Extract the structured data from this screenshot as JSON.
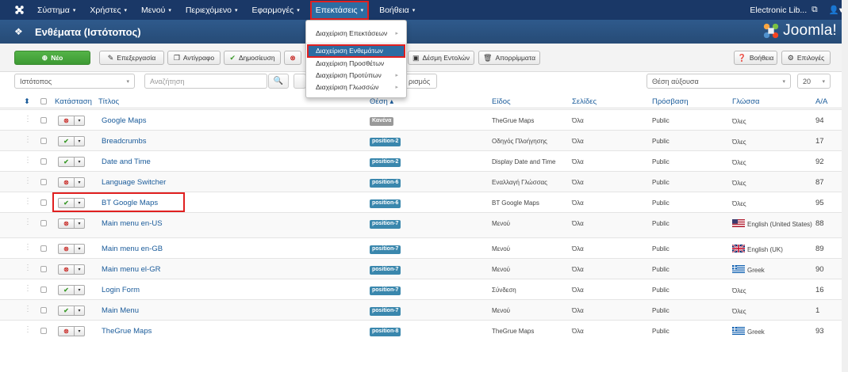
{
  "navbar": {
    "menus": [
      "Σύστημα",
      "Χρήστες",
      "Μενού",
      "Περιεχόμενο",
      "Εφαρμογές",
      "Επεκτάσεις",
      "Βοήθεια"
    ],
    "site_name": "Electronic Lib...",
    "site_icon": "external-link-icon",
    "user_icon": "user-icon"
  },
  "title": {
    "text": "Ενθέματα (Ιστότοπος)",
    "brand": "Joomla!"
  },
  "dropdown": {
    "items": [
      "Διαχείριση Επεκτάσεων",
      "Διαχείριση Ενθεμάτων",
      "Διαχείριση Προσθέτων",
      "Διαχείριση Προτύπων",
      "Διαχείριση Γλωσσών"
    ]
  },
  "toolbar": {
    "new": "Νέο",
    "edit": "Επεξεργασία",
    "copy": "Αντίγραφο",
    "publish": "Δημοσίευση",
    "batch": "Δέσμη Εντολών",
    "trash": "Απορρίμματα",
    "help": "Βοήθεια",
    "options": "Επιλογές"
  },
  "filter": {
    "client": "Ιστότοπος",
    "search_placeholder": "Αναζήτηση",
    "clear_partial": "ρισμός",
    "sort": "Θέση αύξουσα",
    "limit": "20"
  },
  "table": {
    "headers": {
      "status": "Κατάσταση",
      "title": "Τίτλος",
      "position": "Θέση",
      "type": "Είδος",
      "pages": "Σελίδες",
      "access": "Πρόσβαση",
      "language": "Γλώσσα",
      "id": "A/A"
    },
    "rows": [
      {
        "published": false,
        "title": "Google Maps",
        "position": "Κανένα",
        "type": "TheGrue Maps",
        "pages": "Όλα",
        "access": "Public",
        "language": "Όλες",
        "id": "94"
      },
      {
        "published": true,
        "title": "Breadcrumbs",
        "position": "position-2",
        "type": "Οδηγός Πλοήγησης",
        "pages": "Όλα",
        "access": "Public",
        "language": "Όλες",
        "id": "17"
      },
      {
        "published": true,
        "title": "Date and Time",
        "position": "position-2",
        "type": "Display Date and Time",
        "pages": "Όλα",
        "access": "Public",
        "language": "Όλες",
        "id": "92"
      },
      {
        "published": false,
        "title": "Language Switcher",
        "position": "position-6",
        "type": "Εναλλαγή Γλώσσας",
        "pages": "Όλα",
        "access": "Public",
        "language": "Όλες",
        "id": "87"
      },
      {
        "published": true,
        "title": "BT Google Maps",
        "position": "position-6",
        "type": "BT Google Maps",
        "pages": "Όλα",
        "access": "Public",
        "language": "Όλες",
        "id": "95"
      },
      {
        "published": false,
        "title": "Main menu en-US",
        "position": "position-7",
        "type": "Μενού",
        "pages": "Όλα",
        "access": "Public",
        "language": "English (United States)",
        "flag": "us",
        "id": "88"
      },
      {
        "published": false,
        "title": "Main menu en-GB",
        "position": "position-7",
        "type": "Μενού",
        "pages": "Όλα",
        "access": "Public",
        "language": "English (UK)",
        "flag": "gb",
        "id": "89"
      },
      {
        "published": false,
        "title": "Main menu el-GR",
        "position": "position-7",
        "type": "Μενού",
        "pages": "Όλα",
        "access": "Public",
        "language": "Greek",
        "flag": "gr",
        "id": "90"
      },
      {
        "published": true,
        "title": "Login Form",
        "position": "position-7",
        "type": "Σύνδεση",
        "pages": "Όλα",
        "access": "Public",
        "language": "Όλες",
        "id": "16"
      },
      {
        "published": true,
        "title": "Main Menu",
        "position": "position-7",
        "type": "Μενού",
        "pages": "Όλα",
        "access": "Public",
        "language": "Όλες",
        "id": "1"
      },
      {
        "published": false,
        "title": "TheGrue Maps",
        "position": "position-8",
        "type": "TheGrue Maps",
        "pages": "Όλα",
        "access": "Public",
        "language": "Greek",
        "flag": "gr",
        "id": "93"
      }
    ]
  },
  "colors": {
    "navbar": "#1a3867",
    "title_bar": "#2e5686",
    "link": "#1a5b9a",
    "badge": "#3a87ad",
    "new_button": "#46a546",
    "highlight": "#e02020"
  }
}
